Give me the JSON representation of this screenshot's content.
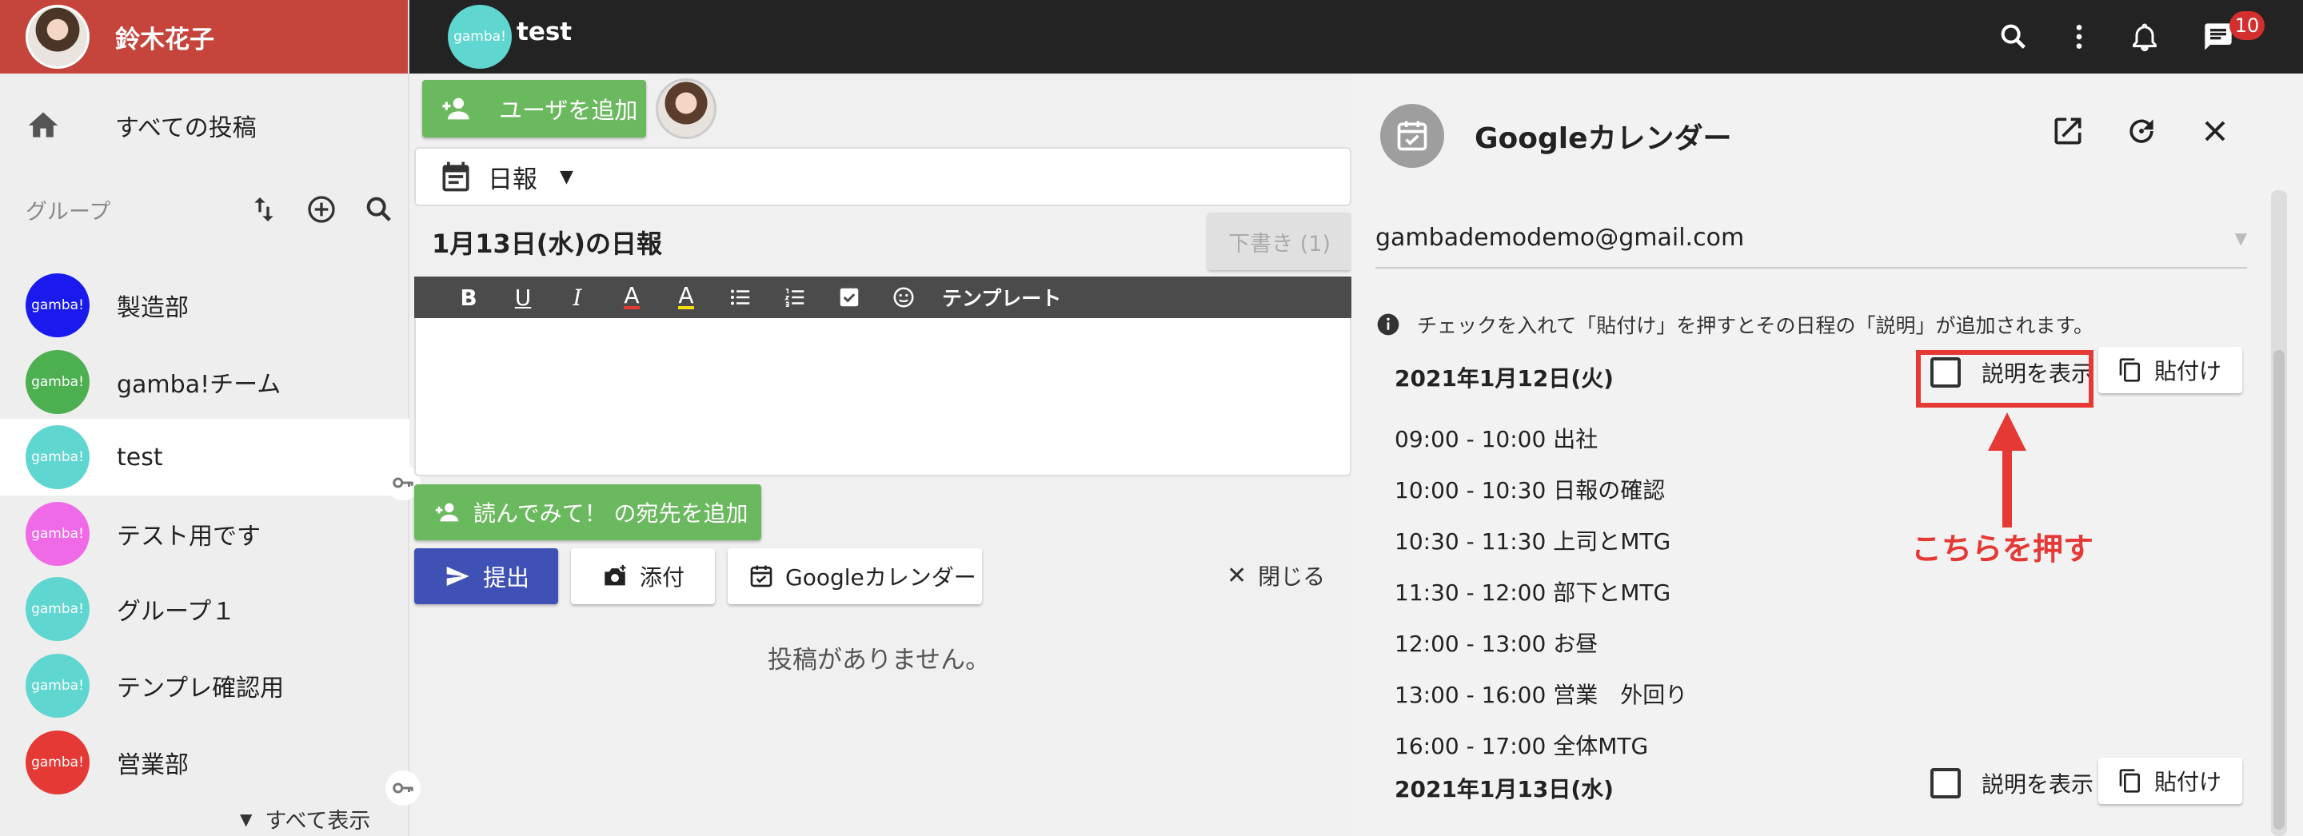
{
  "sidebar": {
    "user_name": "鈴木花子",
    "all_posts": "すべての投稿",
    "group_title": "グループ",
    "groups": [
      {
        "name": "製造部",
        "avatar_text": "gamba!",
        "color": "#1a1aee",
        "key": false,
        "active": false
      },
      {
        "name": "gamba!チーム",
        "avatar_text": "gamba!",
        "color": "#4caf50",
        "key": false,
        "active": false
      },
      {
        "name": "test",
        "avatar_text": "gamba!",
        "color": "#5fd6d0",
        "key": true,
        "active": true
      },
      {
        "name": "テスト用です",
        "avatar_text": "gamba!",
        "color": "#f06ae8",
        "key": false,
        "active": false
      },
      {
        "name": "グループ１",
        "avatar_text": "gamba!",
        "color": "#5fd6d0",
        "key": false,
        "active": false
      },
      {
        "name": "テンプレ確認用",
        "avatar_text": "gamba!",
        "color": "#5fd6d0",
        "key": false,
        "active": false
      },
      {
        "name": "営業部",
        "avatar_text": "gamba!",
        "color": "#e53935",
        "key": true,
        "active": false
      }
    ],
    "show_all": "すべて表示"
  },
  "topbar": {
    "room_avatar_text": "gamba!",
    "room_name": "test",
    "notification_count": "10"
  },
  "compose": {
    "add_user": "ユーザを追加",
    "post_type": "日報",
    "post_title": "1月13日(水)の日報",
    "draft": "下書き (1)",
    "template": "テンプレート",
    "add_reader": "読んでみて！ の宛先を追加",
    "submit": "提出",
    "attach": "添付",
    "google_calendar": "Googleカレンダー",
    "close": "閉じる",
    "no_posts": "投稿がありません。"
  },
  "calendar": {
    "title": "Googleカレンダー",
    "account": "gambademodemo@gmail.com",
    "info": "チェックを入れて「貼付け」を押すとその日程の「説明」が追加されます。",
    "show_description": "説明を表示",
    "paste": "貼付け",
    "days": [
      {
        "date": "2021年1月12日(火)",
        "events": [
          "09:00 - 10:00 出社",
          "10:00 - 10:30 日報の確認",
          "10:30 - 11:30 上司とMTG",
          "11:30 - 12:00 部下とMTG",
          "12:00 - 13:00 お昼",
          "13:00 - 16:00 営業　外回り",
          "16:00 - 17:00 全体MTG"
        ]
      },
      {
        "date": "2021年1月13日(水)",
        "events": []
      }
    ]
  },
  "annotation": {
    "callout": "こちらを押す",
    "color": "#e53935"
  }
}
